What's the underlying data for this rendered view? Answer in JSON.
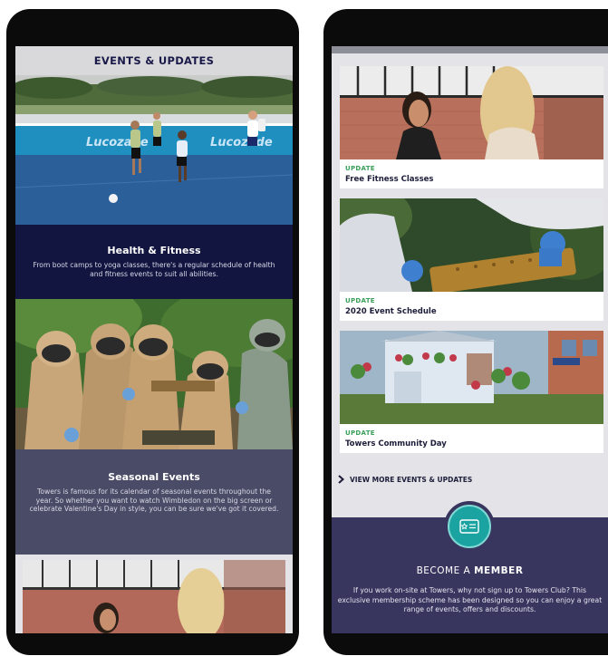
{
  "left_screen": {
    "header_title": "EVENTS & UPDATES",
    "banner_text": "Lucozade",
    "cards": [
      {
        "title": "Health & Fitness",
        "description": "From boot camps to yoga classes, there's a regular schedule of health and fitness events to suit all abilities."
      },
      {
        "title": "Seasonal Events",
        "description": "Towers is famous for its calendar of seasonal events throughout the year. So whether you want to watch Wimbledon on the big screen or celebrate Valentine's Day in style, you can be sure we've got it covered."
      }
    ]
  },
  "right_screen": {
    "updates": [
      {
        "tag": "UPDATE",
        "title": "Free Fitness Classes"
      },
      {
        "tag": "UPDATE",
        "title": "2020 Event Schedule"
      },
      {
        "tag": "UPDATE",
        "title": "Towers Community Day"
      }
    ],
    "view_more_label": "VIEW MORE EVENTS & UPDATES",
    "member": {
      "title_prefix": "BECOME A ",
      "title_bold": "MEMBER",
      "description": "If you work on-site at Towers, why not sign up to Towers Club? This exclusive membership scheme has been designed so you can enjoy a great range of events, offers and discounts."
    }
  },
  "colors": {
    "navy_panel": "#111540",
    "slate_panel": "#4a4b66",
    "member_panel": "#38355e",
    "update_green": "#3aa05a",
    "badge_teal": "#1aa3a0"
  },
  "icons": [
    "chevron-right-icon",
    "membership-card-icon"
  ]
}
